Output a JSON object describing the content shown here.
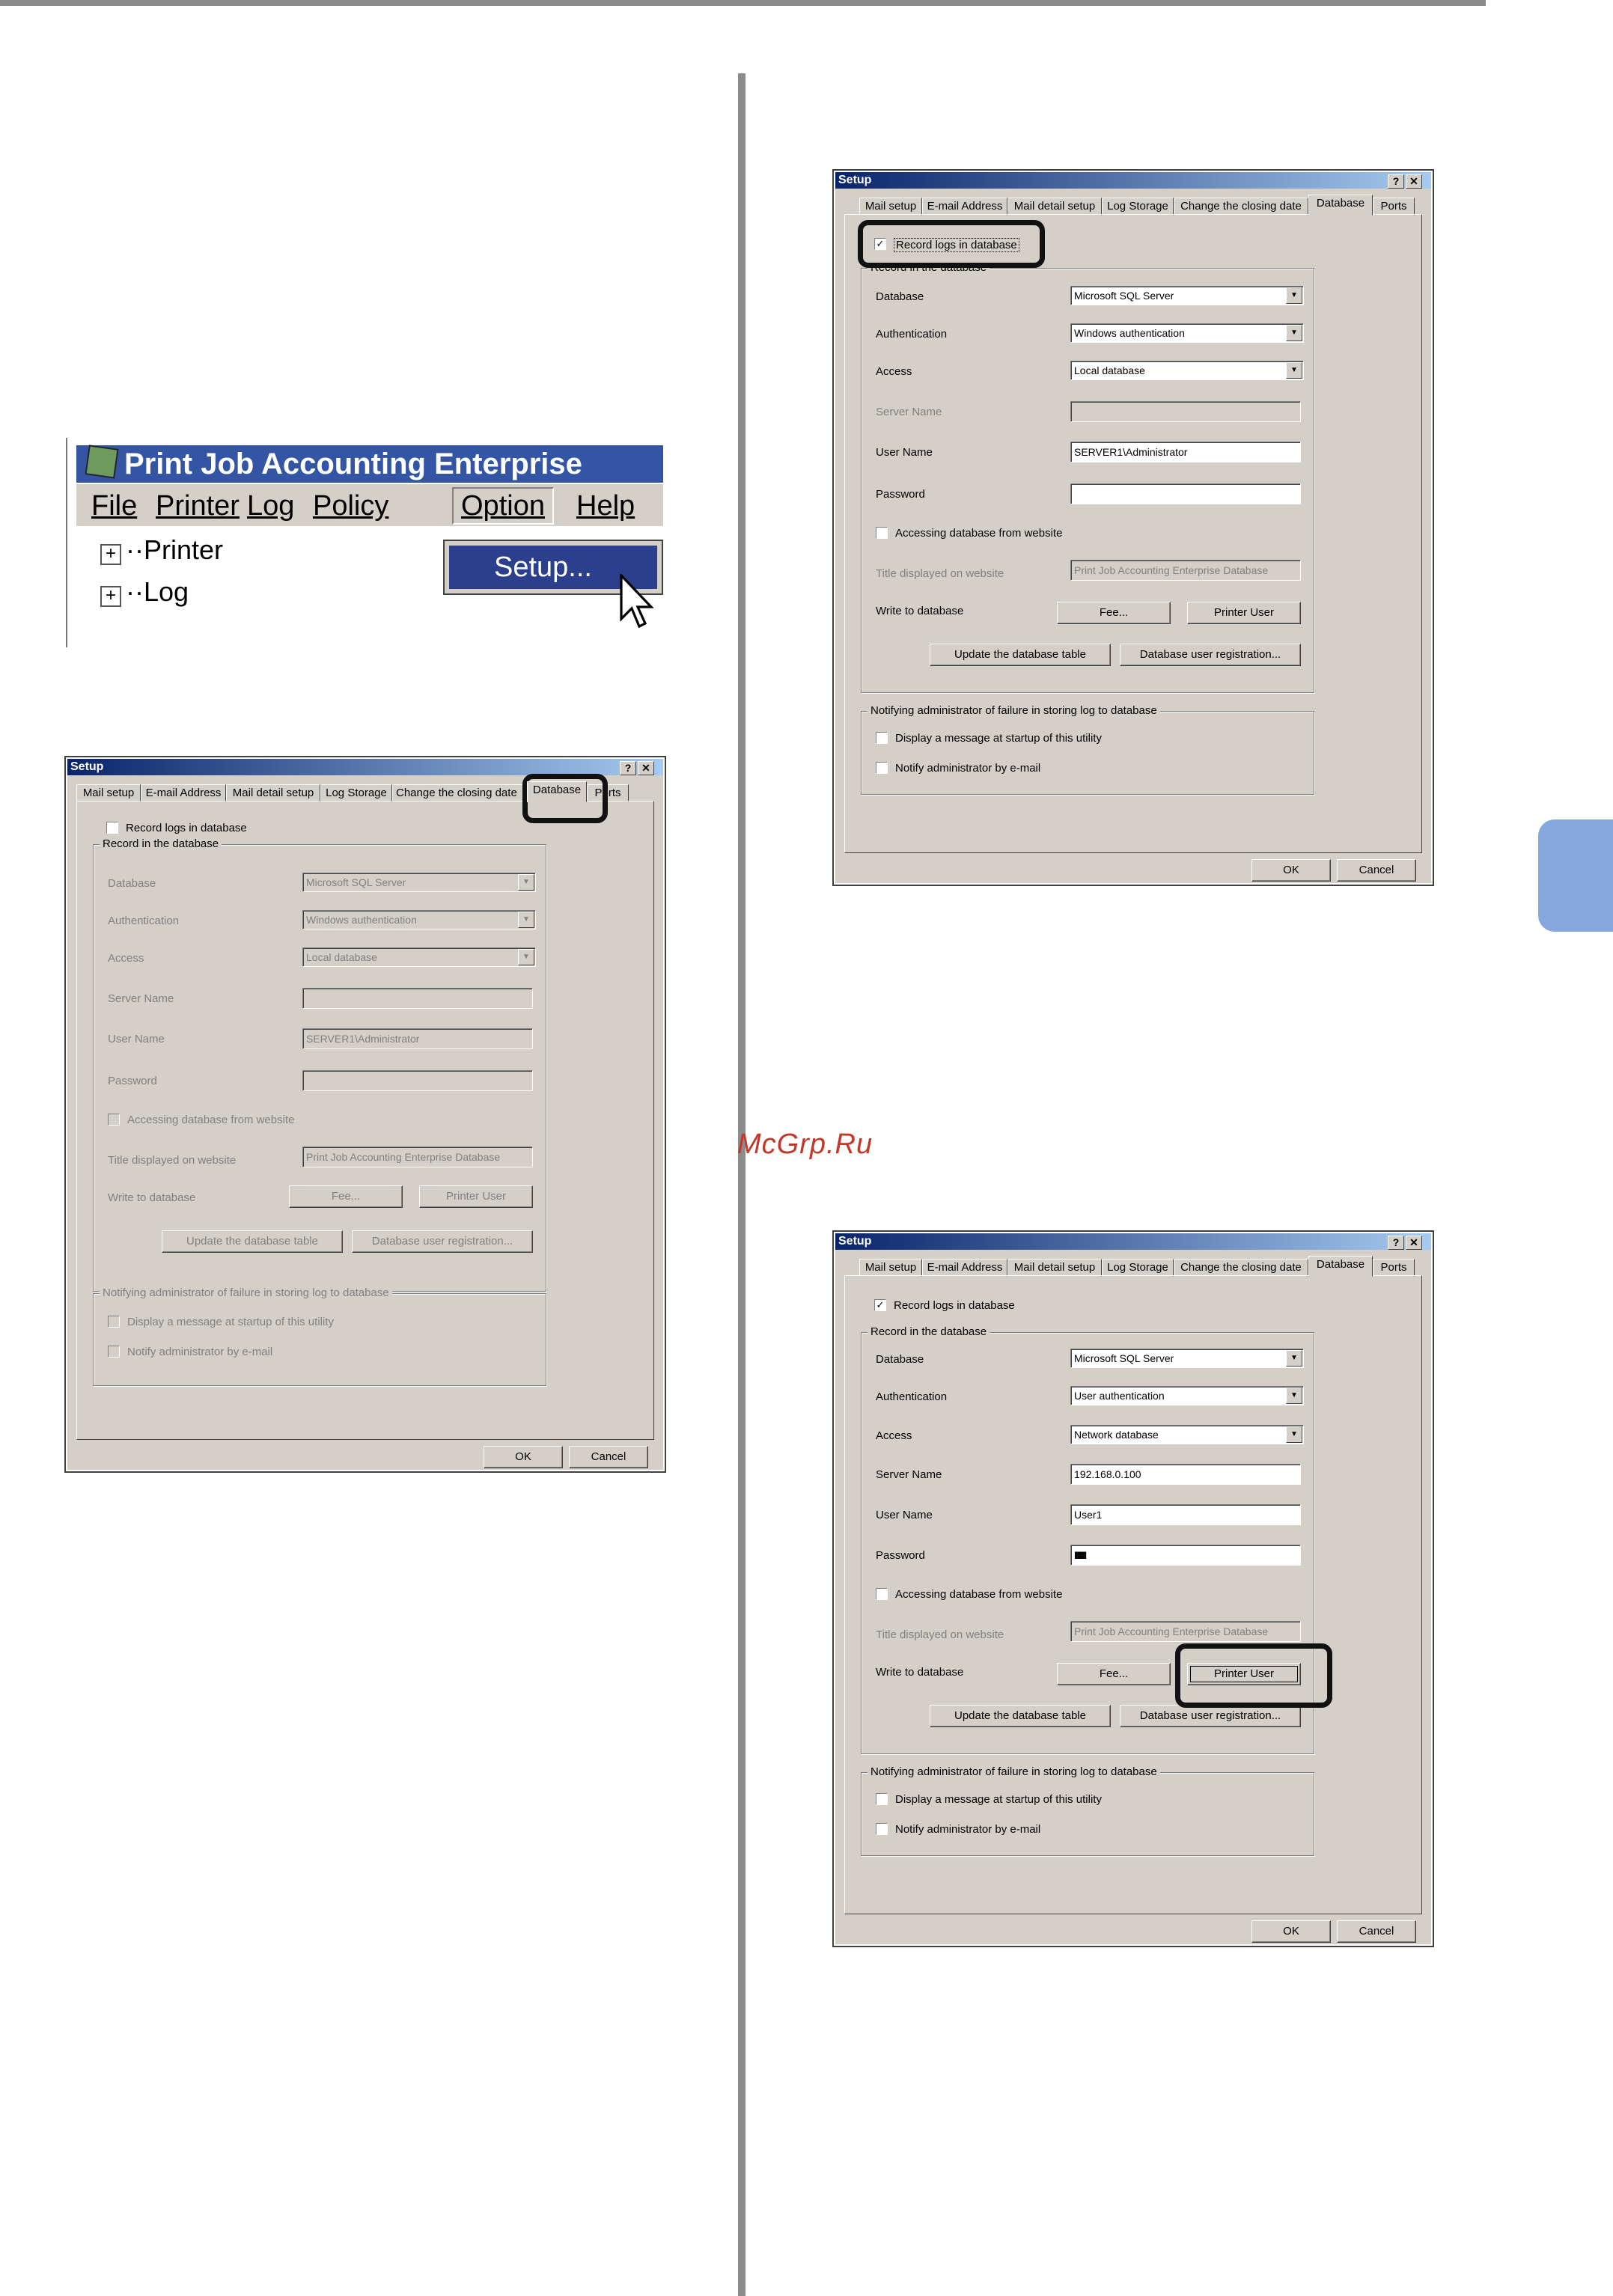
{
  "watermark": "McGrp.Ru",
  "menu_shot": {
    "app_title": "Print Job Accounting Enterprise",
    "menus": [
      "File",
      "Printer",
      "Log",
      "Policy",
      "Option",
      "Help"
    ],
    "dropdown_item": "Setup...",
    "tree": [
      "Printer",
      "Log"
    ]
  },
  "dialog": {
    "title": "Setup",
    "help_btn": "?",
    "close_btn": "✕",
    "tabs": [
      "Mail setup",
      "E-mail Address",
      "Mail detail setup",
      "Log Storage",
      "Change the closing date",
      "Database",
      "Ports"
    ],
    "tabs_clipped": [
      "Mail setup",
      "E-mail Address",
      "Mail detail setup",
      "Log Storage",
      "Change the closing date",
      "Database",
      "Ports"
    ],
    "record_logs": "Record logs in database",
    "group_record": "Record in the database",
    "lbl_database": "Database",
    "lbl_authentication": "Authentication",
    "lbl_access": "Access",
    "lbl_server": "Server Name",
    "lbl_user": "User Name",
    "lbl_password": "Password",
    "accessing_web": "Accessing database from website",
    "lbl_title_web": "Title displayed on website",
    "title_web_value": "Print Job Accounting Enterprise Database",
    "lbl_write": "Write to database",
    "btn_fee": "Fee...",
    "btn_printer_user": "Printer User",
    "btn_update_table": "Update the database table",
    "btn_db_user_reg": "Database user registration...",
    "group_notify": "Notifying administrator of failure in storing log to database",
    "display_msg": "Display a message at startup of this utility",
    "notify_email": "Notify administrator by e-mail",
    "btn_ok": "OK",
    "btn_cancel": "Cancel"
  },
  "dlg_a": {
    "database": "Microsoft SQL Server",
    "authentication": "Windows authentication",
    "access": "Local database",
    "server": "",
    "user": "SERVER1\\Administrator",
    "password": ""
  },
  "dlg_b": {
    "database": "Microsoft SQL Server",
    "authentication": "Windows authentication",
    "access": "Local database",
    "server": "",
    "user": "SERVER1\\Administrator",
    "password": "",
    "checked": "✓"
  },
  "dlg_c": {
    "database": "Microsoft SQL Server",
    "authentication": "User authentication",
    "access": "Network database",
    "server": "192.168.0.100",
    "user": "User1",
    "password": "IIIIIIII",
    "checked": "✓"
  }
}
